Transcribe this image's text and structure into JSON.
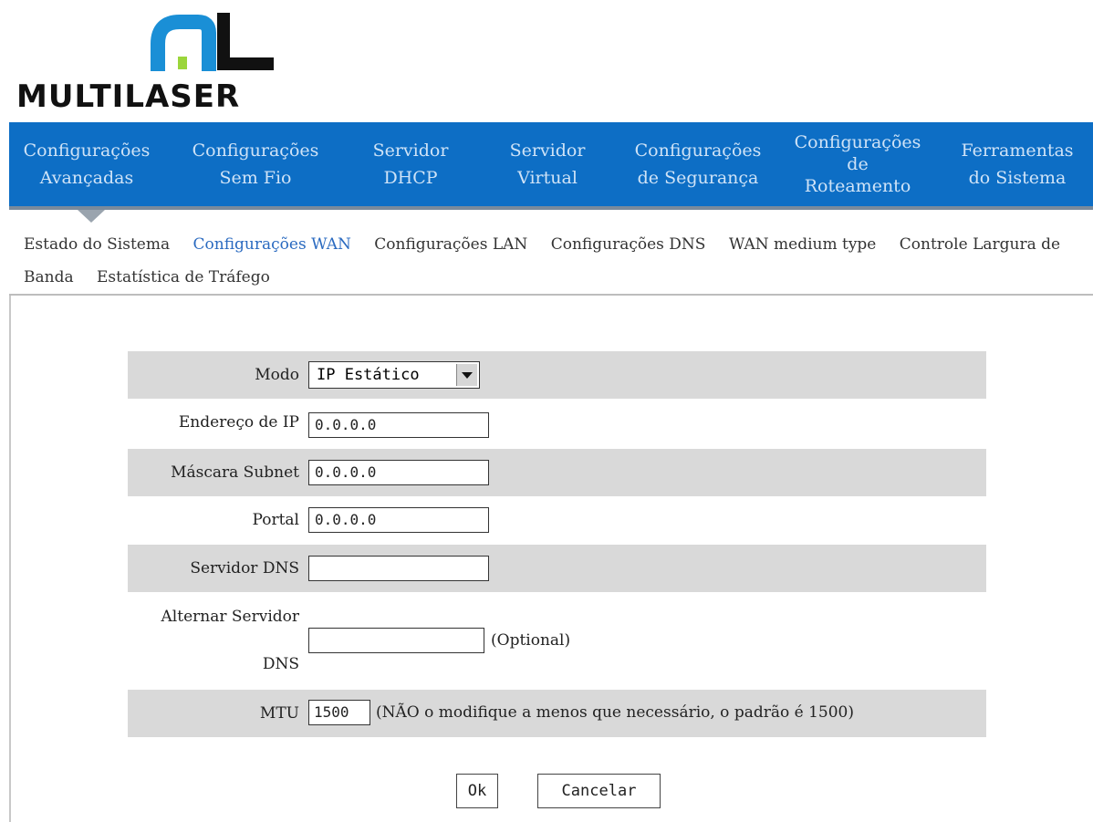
{
  "brand": {
    "logo_text": "MULTILASER",
    "accent": "#0d6ec5"
  },
  "top_nav": [
    {
      "label": "Configurações\nAvançadas"
    },
    {
      "label": "Configurações\nSem Fio"
    },
    {
      "label": "Servidor\nDHCP"
    },
    {
      "label": "Servidor\nVirtual"
    },
    {
      "label": "Configurações\nde Segurança"
    },
    {
      "label": "Configurações\nde\nRoteamento"
    },
    {
      "label": "Ferramentas\ndo Sistema"
    }
  ],
  "sub_nav": [
    {
      "label": "Estado do Sistema",
      "active": false
    },
    {
      "label": "Configurações WAN",
      "active": true
    },
    {
      "label": "Configurações LAN",
      "active": false
    },
    {
      "label": "Configurações DNS",
      "active": false
    },
    {
      "label": "WAN medium type",
      "active": false
    },
    {
      "label": "Controle Largura de Banda",
      "active": false
    },
    {
      "label": "Estatística de Tráfego",
      "active": false
    }
  ],
  "form": {
    "mode_label": "Modo",
    "mode_value": "IP Estático",
    "ip_label": "Endereço de IP",
    "ip_value": "0.0.0.0",
    "mask_label": "Máscara Subnet",
    "mask_value": "0.0.0.0",
    "gateway_label": "Portal",
    "gateway_value": "0.0.0.0",
    "dns_label": "Servidor DNS",
    "dns_value": "",
    "alt_dns_label_1": "Alternar Servidor",
    "alt_dns_label_2": "DNS",
    "alt_dns_value": "",
    "alt_dns_note": "(Optional)",
    "mtu_label": "MTU",
    "mtu_value": "1500",
    "mtu_note": "(NÃO o modifique a menos que necessário, o padrão é 1500)"
  },
  "buttons": {
    "ok": "Ok",
    "cancel": "Cancelar"
  }
}
